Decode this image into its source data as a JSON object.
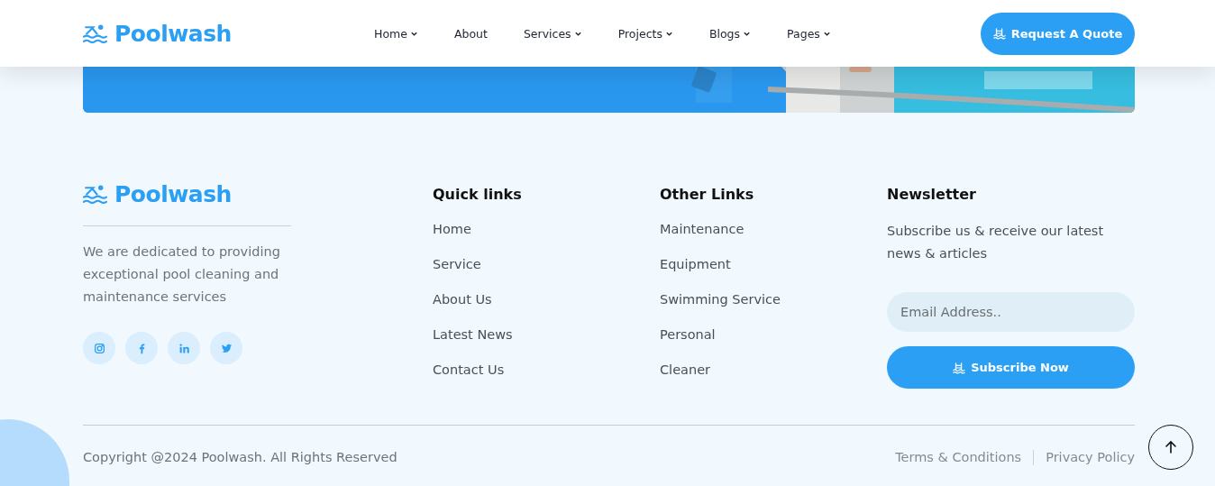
{
  "header": {
    "logo": "Poolwash",
    "nav": [
      {
        "label": "Home",
        "dropdown": true
      },
      {
        "label": "About",
        "dropdown": false
      },
      {
        "label": "Services",
        "dropdown": true
      },
      {
        "label": "Projects",
        "dropdown": true
      },
      {
        "label": "Blogs",
        "dropdown": true
      },
      {
        "label": "Pages",
        "dropdown": true
      }
    ],
    "cta": "Request A Quote"
  },
  "footer": {
    "logo": "Poolwash",
    "about": "We are dedicated to providing exceptional pool cleaning and maintenance services",
    "socials": [
      {
        "kind": "instagram"
      },
      {
        "kind": "facebook"
      },
      {
        "kind": "linkedin"
      },
      {
        "kind": "twitter"
      }
    ],
    "columns": [
      {
        "title": "Quick links",
        "links": [
          "Home",
          "Service",
          "About Us",
          "Latest News",
          "Contact Us"
        ]
      },
      {
        "title": "Other Links",
        "links": [
          "Maintenance",
          "Equipment",
          "Swimming Service",
          "Personal",
          "Cleaner"
        ]
      }
    ],
    "newsletter": {
      "title": "Newsletter",
      "text": "Subscribe us & receive our latest news & articles",
      "placeholder": "Email Address..",
      "button": "Subscribe Now"
    },
    "copyright": "Copyright @2024 Poolwash. All Rights Reserved",
    "legal": [
      "Terms & Conditions",
      "Privacy Policy"
    ]
  }
}
